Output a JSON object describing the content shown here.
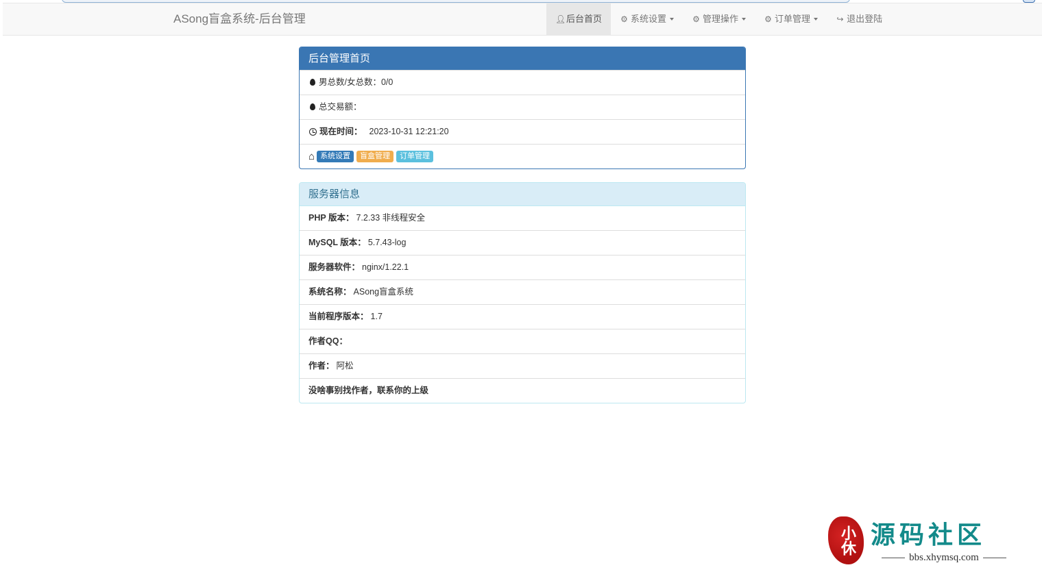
{
  "brand": "ASong盲盒系统-后台管理",
  "nav": [
    {
      "label": "后台首页",
      "icon": "user-icon",
      "active": true,
      "dropdown": false
    },
    {
      "label": "系统设置",
      "icon": "gear-icon",
      "active": false,
      "dropdown": true
    },
    {
      "label": "管理操作",
      "icon": "gear-icon",
      "active": false,
      "dropdown": true
    },
    {
      "label": "订单管理",
      "icon": "gear-icon",
      "active": false,
      "dropdown": true
    },
    {
      "label": "退出登陆",
      "icon": "logout-icon",
      "active": false,
      "dropdown": false
    }
  ],
  "home_panel": {
    "title": "后台管理首页",
    "gender_label": "男总数/女总数：",
    "gender_value": "0/0",
    "trade_label": "总交易额：",
    "trade_value": "",
    "time_label": "现在时间：",
    "time_value": "2023-10-31 12:21:20",
    "shortcuts": [
      "系统设置",
      "盲盒管理",
      "订单管理"
    ]
  },
  "server_panel": {
    "title": "服务器信息",
    "rows": [
      {
        "label": "PHP 版本：",
        "value": "7.2.33 非线程安全"
      },
      {
        "label": "MySQL 版本：",
        "value": "5.7.43-log"
      },
      {
        "label": "服务器软件：",
        "value": "nginx/1.22.1"
      },
      {
        "label": "系统名称：",
        "value": "ASong盲盒系统"
      },
      {
        "label": "当前程序版本：",
        "value": "1.7"
      },
      {
        "label": "作者QQ：",
        "value": ""
      },
      {
        "label": "作者：",
        "value": "阿松"
      },
      {
        "label": "没啥事别找作者，联系你的上级",
        "value": ""
      }
    ]
  },
  "watermark": {
    "seal": "小休",
    "title": "源码社区",
    "url": "bbs.xhymsq.com"
  }
}
